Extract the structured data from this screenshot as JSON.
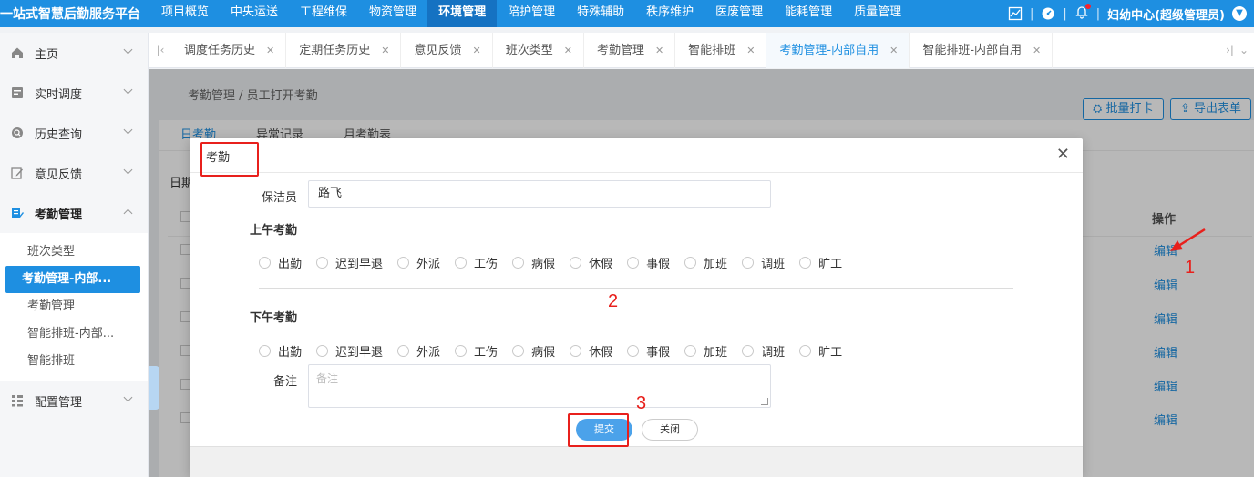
{
  "app": {
    "title": "一站式智慧后勤服务平台"
  },
  "topnav": [
    {
      "label": "项目概览",
      "active": false
    },
    {
      "label": "中央运送",
      "active": false
    },
    {
      "label": "工程维保",
      "active": false
    },
    {
      "label": "物资管理",
      "active": false
    },
    {
      "label": "环境管理",
      "active": true
    },
    {
      "label": "陪护管理",
      "active": false
    },
    {
      "label": "特殊辅助",
      "active": false
    },
    {
      "label": "秩序维护",
      "active": false
    },
    {
      "label": "医废管理",
      "active": false
    },
    {
      "label": "能耗管理",
      "active": false
    },
    {
      "label": "质量管理",
      "active": false
    }
  ],
  "user": {
    "name": "妇幼中心(超级管理员)"
  },
  "sidebar": {
    "items": [
      {
        "label": "主页"
      },
      {
        "label": "实时调度"
      },
      {
        "label": "历史查询"
      },
      {
        "label": "意见反馈"
      },
      {
        "label": "考勤管理"
      },
      {
        "label": "配置管理"
      }
    ],
    "sub": [
      {
        "label": "班次类型"
      },
      {
        "label": "考勤管理-内部..."
      },
      {
        "label": "考勤管理"
      },
      {
        "label": "智能排班-内部..."
      },
      {
        "label": "智能排班"
      }
    ]
  },
  "tabs": [
    {
      "label": "调度任务历史"
    },
    {
      "label": "定期任务历史"
    },
    {
      "label": "意见反馈"
    },
    {
      "label": "班次类型"
    },
    {
      "label": "考勤管理"
    },
    {
      "label": "智能排班"
    },
    {
      "label": "考勤管理-内部自用"
    },
    {
      "label": "智能排班-内部自用"
    }
  ],
  "page": {
    "breadcrumb": "考勤管理 / 员工打开考勤",
    "subtabs": [
      "日考勤",
      "异常记录",
      "月考勤表"
    ],
    "date_label": "日期",
    "batch_btn": "批量打卡",
    "export_btn": "导出表单",
    "op_col": "操作",
    "edit_label": "编辑"
  },
  "dialog": {
    "title": "考勤",
    "cleaner_label": "保洁员",
    "cleaner_value": "路飞",
    "am_title": "上午考勤",
    "pm_title": "下午考勤",
    "options": [
      "出勤",
      "迟到早退",
      "外派",
      "工伤",
      "病假",
      "休假",
      "事假",
      "加班",
      "调班",
      "旷工"
    ],
    "remark_label": "备注",
    "remark_placeholder": "备注",
    "submit": "提交",
    "close": "关闭"
  },
  "annotations": {
    "n1": "1",
    "n2": "2",
    "n3": "3"
  },
  "colors": {
    "primary": "#1e8fe1",
    "annotation": "#e8201c"
  }
}
